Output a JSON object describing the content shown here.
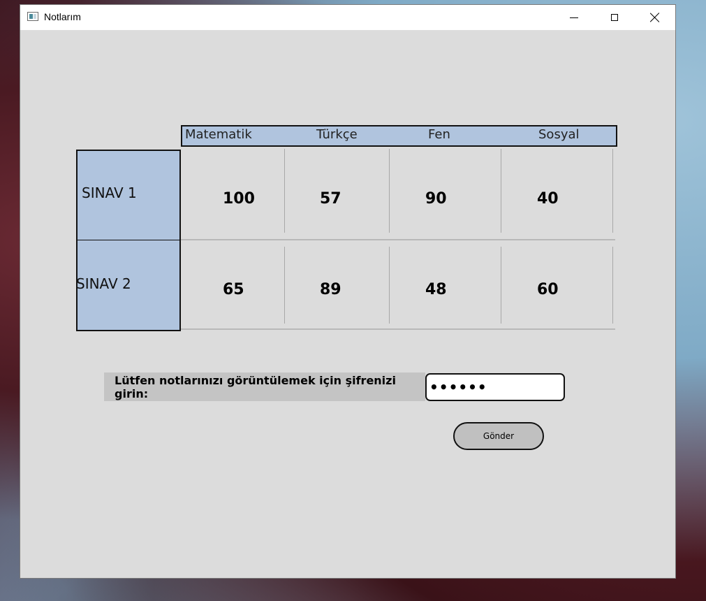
{
  "window": {
    "title": "Notlarım",
    "controls": {
      "minimize": "minimize",
      "maximize": "maximize",
      "close": "close"
    }
  },
  "table": {
    "headers": [
      "Matematik",
      "Türkçe",
      "Fen",
      "Sosyal"
    ],
    "rows": [
      {
        "label": "SINAV 1",
        "scores": [
          "100",
          "57",
          "90",
          "40"
        ]
      },
      {
        "label": "SINAV 2",
        "scores": [
          "65",
          "89",
          "48",
          "60"
        ]
      }
    ]
  },
  "form": {
    "prompt": "Lütfen notlarınızı görüntülemek için şifrenizi girin:",
    "password_value": "••••••",
    "submit_label": "Gönder"
  },
  "colors": {
    "header_bg": "#b0c4de",
    "window_bg": "#dcdcdc",
    "prompt_bg": "#c4c4c4",
    "button_bg": "#c0c0c0"
  }
}
